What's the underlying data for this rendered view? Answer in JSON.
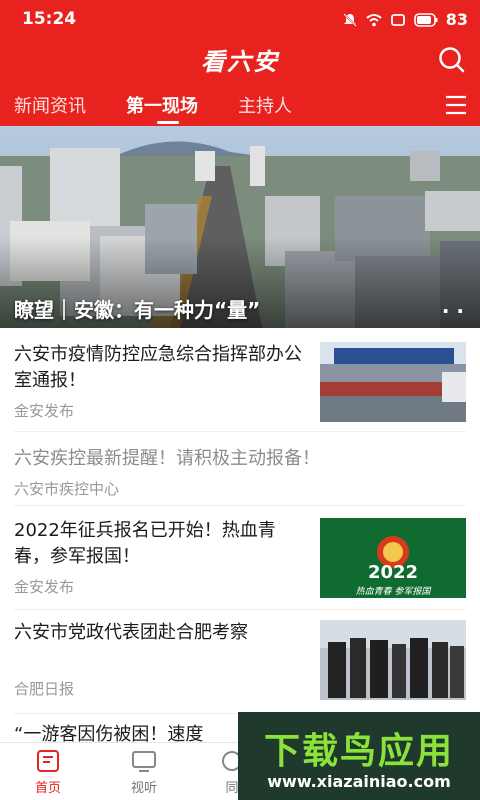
{
  "status_bar": {
    "time": "15:24",
    "battery": "83"
  },
  "app": {
    "title": "看六安"
  },
  "tabs": [
    {
      "label": "新闻资讯",
      "active": false
    },
    {
      "label": "第一现场",
      "active": true
    },
    {
      "label": "主持人",
      "active": false
    }
  ],
  "hero": {
    "title": "瞭望｜安徽：有一种力“量”",
    "more": ". ."
  },
  "news": [
    {
      "title": "六安市疫情防控应急综合指挥部办公室通报！",
      "source": "金安发布",
      "read": false,
      "thumb": "photo"
    },
    {
      "title": "六安疾控最新提醒！请积极主动报备！",
      "source": "六安市疾控中心",
      "read": true,
      "thumb": null
    },
    {
      "title": "2022年征兵报名已开始！热血青春，参军报国！",
      "source": "金安发布",
      "read": false,
      "thumb": "poster",
      "thumb_text": "2022",
      "thumb_caption": "热血青春 参军报国"
    },
    {
      "title": "六安市党政代表团赴合肥考察",
      "source": "合肥日报",
      "read": false,
      "thumb": "photo"
    },
    {
      "title": "“一游客因伤被困！速度",
      "source": "",
      "read": false,
      "thumb": null
    }
  ],
  "bottom_nav": [
    {
      "label": "首页",
      "active": true,
      "icon": "home-icon"
    },
    {
      "label": "视听",
      "active": false,
      "icon": "tv-icon"
    },
    {
      "label": "同",
      "active": false,
      "icon": "circle-icon"
    }
  ],
  "watermark": {
    "title": "下载鸟应用",
    "url": "www.xiazainiao.com"
  },
  "colors": {
    "brand": "#e8231f"
  }
}
